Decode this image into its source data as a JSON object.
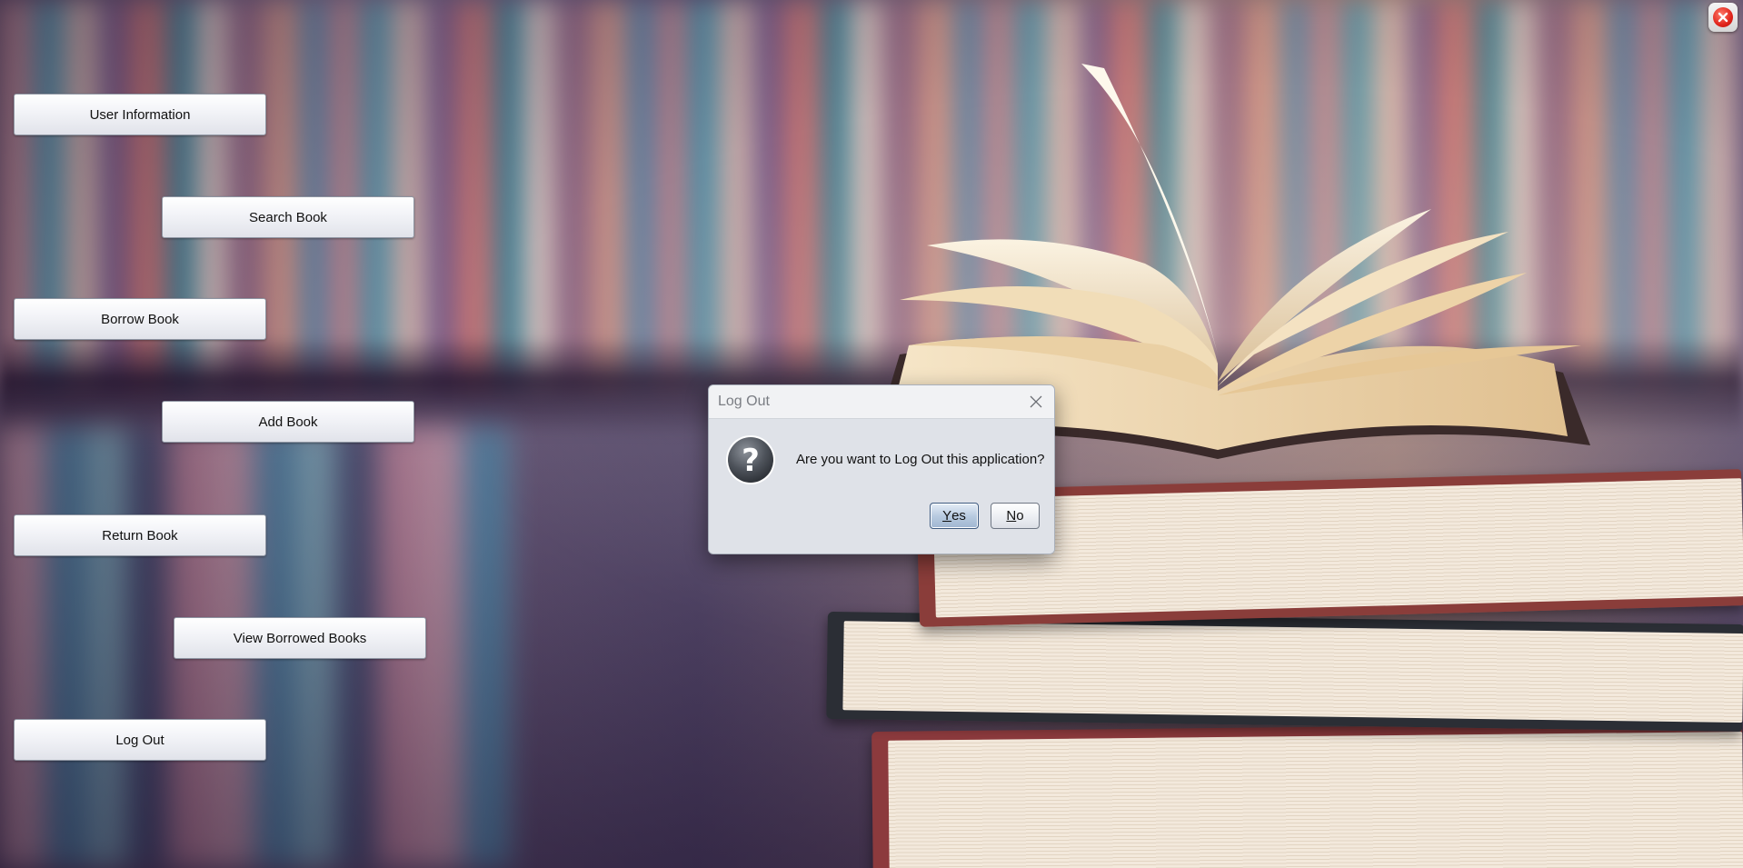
{
  "window": {
    "close_icon": "close-circle-icon",
    "close_color": "#e0241b"
  },
  "menu": {
    "user_information": "User Information",
    "search_book": "Search Book",
    "borrow_book": "Borrow Book",
    "add_book": "Add Book",
    "return_book": "Return Book",
    "view_borrowed_books": "View Borrowed Books",
    "log_out": "Log Out"
  },
  "dialog": {
    "title": "Log Out",
    "message": "Are you want to Log Out this application?",
    "icon": "question-icon",
    "close_icon": "close-x-icon",
    "yes_mnemonic": "Y",
    "yes_rest": "es",
    "no_mnemonic": "N",
    "no_rest": "o"
  },
  "background": {
    "description_image": "bookshelf-books-photo"
  }
}
